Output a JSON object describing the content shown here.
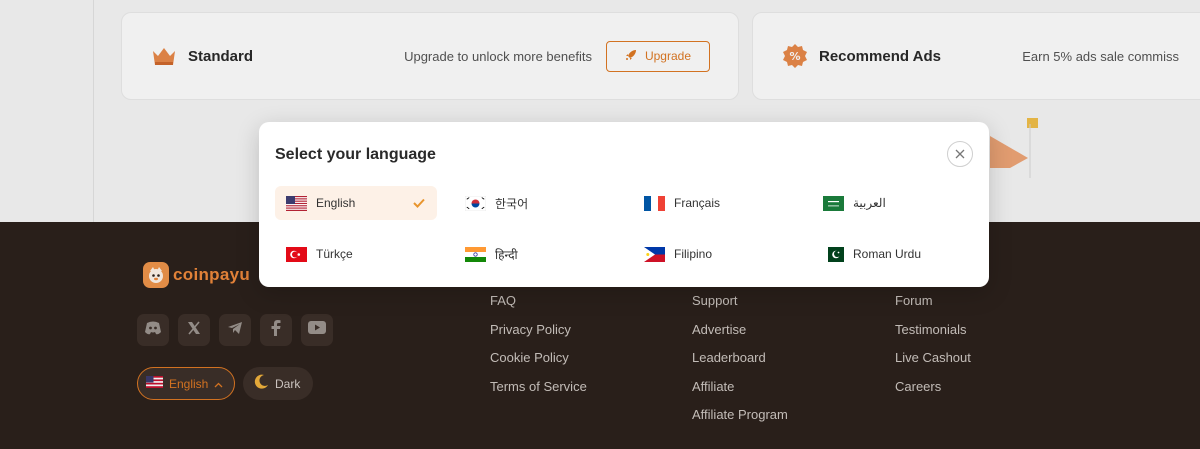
{
  "cards": {
    "standard": {
      "title": "Standard",
      "description": "Upgrade to unlock more benefits",
      "button_label": "Upgrade"
    },
    "ads": {
      "title": "Recommend Ads",
      "description": "Earn 5% ads sale commiss"
    }
  },
  "footer": {
    "brand_name": "coinpayu",
    "socials": [
      "discord-icon",
      "x-icon",
      "telegram-icon",
      "facebook-icon",
      "youtube-icon"
    ],
    "language_button": "English",
    "theme_button": "Dark",
    "columns": [
      [
        "FAQ",
        "Privacy Policy",
        "Cookie Policy",
        "Terms of Service"
      ],
      [
        "Support",
        "Advertise",
        "Leaderboard",
        "Affiliate",
        "Affiliate Program"
      ],
      [
        "Forum",
        "Testimonials",
        "Live Cashout",
        "Careers"
      ]
    ]
  },
  "modal": {
    "title": "Select your language",
    "languages": [
      {
        "label": "English",
        "flag": "us-flag",
        "selected": true
      },
      {
        "label": "한국어",
        "flag": "kr-flag",
        "selected": false
      },
      {
        "label": "Français",
        "flag": "fr-flag",
        "selected": false
      },
      {
        "label": "العربية",
        "flag": "sa-flag",
        "selected": false
      },
      {
        "label": "Türkçe",
        "flag": "tr-flag",
        "selected": false
      },
      {
        "label": "हिन्दी",
        "flag": "in-flag",
        "selected": false
      },
      {
        "label": "Filipino",
        "flag": "ph-flag",
        "selected": false
      },
      {
        "label": "Roman Urdu",
        "flag": "pk-flag",
        "selected": false
      }
    ]
  },
  "colors": {
    "accent": "#e07a24",
    "footer_bg": "#2c211c",
    "selected_bg": "#fdf1e7"
  }
}
